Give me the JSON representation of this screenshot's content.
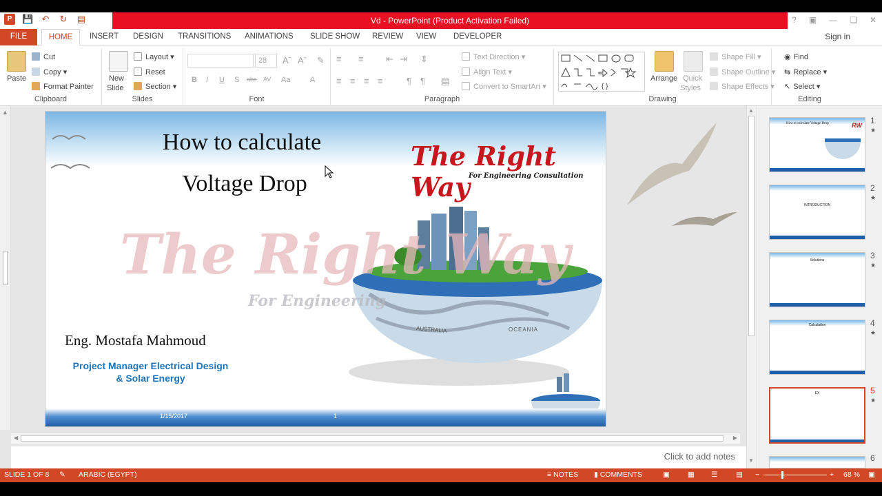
{
  "window": {
    "title": "Vd - PowerPoint (Product Activation Failed)",
    "sign_in": "Sign in"
  },
  "tabs": [
    "FILE",
    "HOME",
    "INSERT",
    "DESIGN",
    "TRANSITIONS",
    "ANIMATIONS",
    "SLIDE SHOW",
    "REVIEW",
    "VIEW",
    "DEVELOPER"
  ],
  "clipboard": {
    "paste": "Paste",
    "cut": "Cut",
    "copy": "Copy",
    "format_painter": "Format Painter",
    "label": "Clipboard"
  },
  "slides_group": {
    "new_slide_1": "New",
    "new_slide_2": "Slide",
    "layout": "Layout",
    "reset": "Reset",
    "section": "Section",
    "label": "Slides"
  },
  "font": {
    "size": "28",
    "label": "Font",
    "bold": "B",
    "italic": "I",
    "underline": "U",
    "shadow": "S",
    "strike": "abc",
    "spacing": "AV",
    "case": "Aa",
    "color": "A"
  },
  "paragraph": {
    "text_direction": "Text Direction",
    "align_text": "Align Text",
    "smartart": "Convert to SmartArt",
    "label": "Paragraph"
  },
  "drawing": {
    "arrange": "Arrange",
    "quick_styles_1": "Quick",
    "quick_styles_2": "Styles",
    "shape_fill": "Shape Fill",
    "shape_outline": "Shape Outline",
    "shape_effects": "Shape Effects",
    "label": "Drawing"
  },
  "editing": {
    "find": "Find",
    "replace": "Replace",
    "select": "Select",
    "label": "Editing"
  },
  "slide": {
    "title_line1": "How to calculate",
    "title_line2": "Voltage Drop",
    "logo_main": "The Right Way",
    "logo_sub": "For Engineering Consultation",
    "watermark_main": "The Right Way",
    "watermark_sub": "For Engineering",
    "author": "Eng. Mostafa Mahmoud",
    "role_line1": "Project Manager Electrical Design",
    "role_line2": "& Solar Energy",
    "globe_label_1": "AUSTRALIA",
    "globe_label_2": "OCEANIA",
    "date": "1/15/2017",
    "number": "1"
  },
  "thumbnails": [
    {
      "num": "1",
      "caption": "How to calculate Voltage Drop"
    },
    {
      "num": "2",
      "caption": "INTRODUCTION"
    },
    {
      "num": "3",
      "caption": "Solutions"
    },
    {
      "num": "4",
      "caption": "Calculation"
    },
    {
      "num": "5",
      "caption": "EX"
    },
    {
      "num": "6",
      "caption": ""
    }
  ],
  "notes_placeholder": "Click to add notes",
  "status": {
    "slide": "SLIDE 1 OF 8",
    "language": "ARABIC (EGYPT)",
    "notes": "NOTES",
    "comments": "COMMENTS",
    "zoom": "68 %"
  },
  "colors": {
    "accent": "#d24726",
    "titlebar": "#e81123",
    "role_text": "#1f73b8",
    "logo": "#c8161e"
  }
}
